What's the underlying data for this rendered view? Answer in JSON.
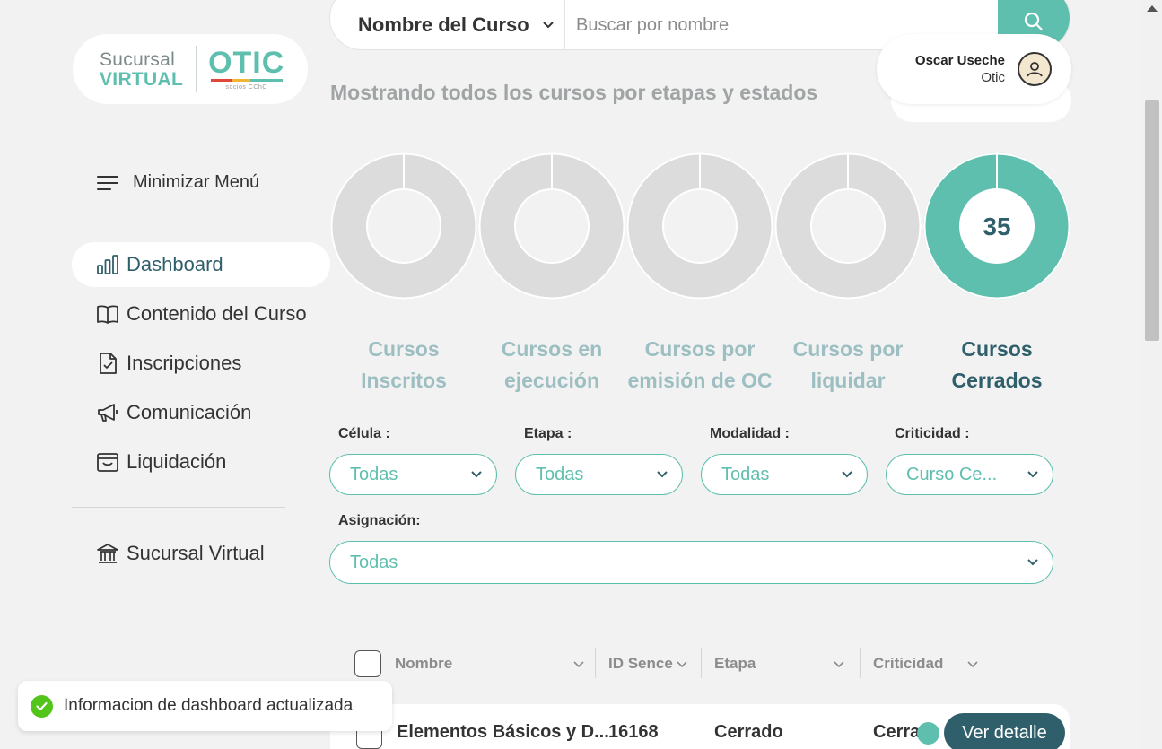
{
  "logo": {
    "line1": "Sucursal",
    "line2": "VIRTUAL",
    "brand": "OTIC",
    "brand_sub": "socios CChC"
  },
  "sidebar": {
    "minimize_label": "Minimizar Menú",
    "items": [
      {
        "label": "Dashboard",
        "icon": "bar-chart-icon"
      },
      {
        "label": "Contenido del Curso",
        "icon": "book-icon"
      },
      {
        "label": "Inscripciones",
        "icon": "document-check-icon"
      },
      {
        "label": "Comunicación",
        "icon": "megaphone-icon"
      },
      {
        "label": "Liquidación",
        "icon": "wallet-icon"
      }
    ],
    "footer_item": {
      "label": "Sucursal Virtual",
      "icon": "bank-icon"
    }
  },
  "search": {
    "field_label": "Nombre del Curso",
    "placeholder": "Buscar por nombre"
  },
  "user": {
    "name": "Oscar Useche",
    "role": "Otic"
  },
  "summary_text": "Mostrando todos los cursos por etapas y estados",
  "stages": [
    {
      "line1": "Cursos",
      "line2": "Inscritos",
      "count": "",
      "active": false
    },
    {
      "line1": "Cursos en",
      "line2": "ejecución",
      "count": "",
      "active": false
    },
    {
      "line1": "Cursos por",
      "line2": "emisión de OC",
      "count": "",
      "active": false
    },
    {
      "line1": "Cursos por",
      "line2": "liquidar",
      "count": "",
      "active": false
    },
    {
      "line1": "Cursos",
      "line2": "Cerrados",
      "count": "35",
      "active": true
    }
  ],
  "filters": {
    "celula": {
      "label": "Célula :",
      "value": "Todas"
    },
    "etapa": {
      "label": "Etapa :",
      "value": "Todas"
    },
    "modalidad": {
      "label": "Modalidad :",
      "value": "Todas"
    },
    "criticidad": {
      "label": "Criticidad :",
      "value": "Curso Ce..."
    },
    "asignacion": {
      "label": "Asignación:",
      "value": "Todas"
    }
  },
  "table": {
    "headers": [
      "Nombre",
      "ID Sence",
      "Etapa",
      "Criticidad"
    ],
    "rows": [
      {
        "nombre": "Elementos Básicos y D...",
        "id_sence": "16168",
        "etapa": "Cerrado",
        "criticidad": "Cerra",
        "action": "Ver detalle"
      }
    ]
  },
  "toast": {
    "message": "Informacion de dashboard actualizada"
  },
  "colors": {
    "accent": "#5fbfae",
    "primary_dark": "#2f5f6a",
    "inactive_donut": "#dcdcdc",
    "inactive_label": "#9dbfc2",
    "success": "#52c41a"
  }
}
